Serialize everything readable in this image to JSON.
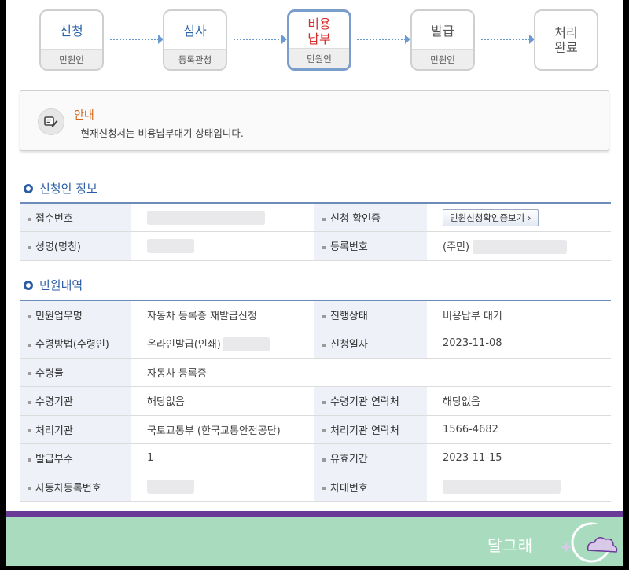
{
  "steps": [
    {
      "name": "신청",
      "sub": "민원인"
    },
    {
      "name": "심사",
      "sub": "등록관청"
    },
    {
      "name": "비용\n납부",
      "sub": "민원인"
    },
    {
      "name": "발급",
      "sub": "민원인"
    },
    {
      "name": "처리\n완료",
      "sub": ""
    }
  ],
  "notice": {
    "title": "안내",
    "desc": "- 현재신청서는 비용납부대기 상태입니다."
  },
  "applicant": {
    "title": "신청인 정보",
    "receipt_label": "접수번호",
    "confirm_label": "신청 확인증",
    "confirm_button": "민원신청확인증보기",
    "name_label": "성명(명칭)",
    "regno_label": "등록번호",
    "regno_prefix": "(주민)"
  },
  "details": {
    "title": "민원내역",
    "rows": [
      {
        "l1": "민원업무명",
        "v1": "자동차 등록증 재발급신청",
        "l2": "진행상태",
        "v2": "비용납부 대기"
      },
      {
        "l1": "수령방법(수령인)",
        "v1": "온라인발급(인쇄)",
        "l2": "신청일자",
        "v2": "2023-11-08"
      },
      {
        "l1": "수령물",
        "v1": "자동차 등록증"
      },
      {
        "l1": "수령기관",
        "v1": "해당없음",
        "l2": "수령기관 연락처",
        "v2": "해당없음"
      },
      {
        "l1": "처리기관",
        "v1": "국토교통부 (한국교통안전공단)",
        "l2": "처리기관 연락처",
        "v2": "1566-4682"
      },
      {
        "l1": "발급부수",
        "v1": "1",
        "l2": "유효기간",
        "v2": "2023-11-15"
      },
      {
        "l1": "자동차등록번호",
        "v1": "",
        "l2": "차대번호",
        "v2": ""
      }
    ]
  },
  "footer": {
    "brand": "달그래"
  },
  "colors": {
    "accent": "#2a5da5",
    "current": "#d42b2b",
    "notice": "#d2651a",
    "purple": "#6b3a96",
    "green": "#a9dcbf"
  }
}
